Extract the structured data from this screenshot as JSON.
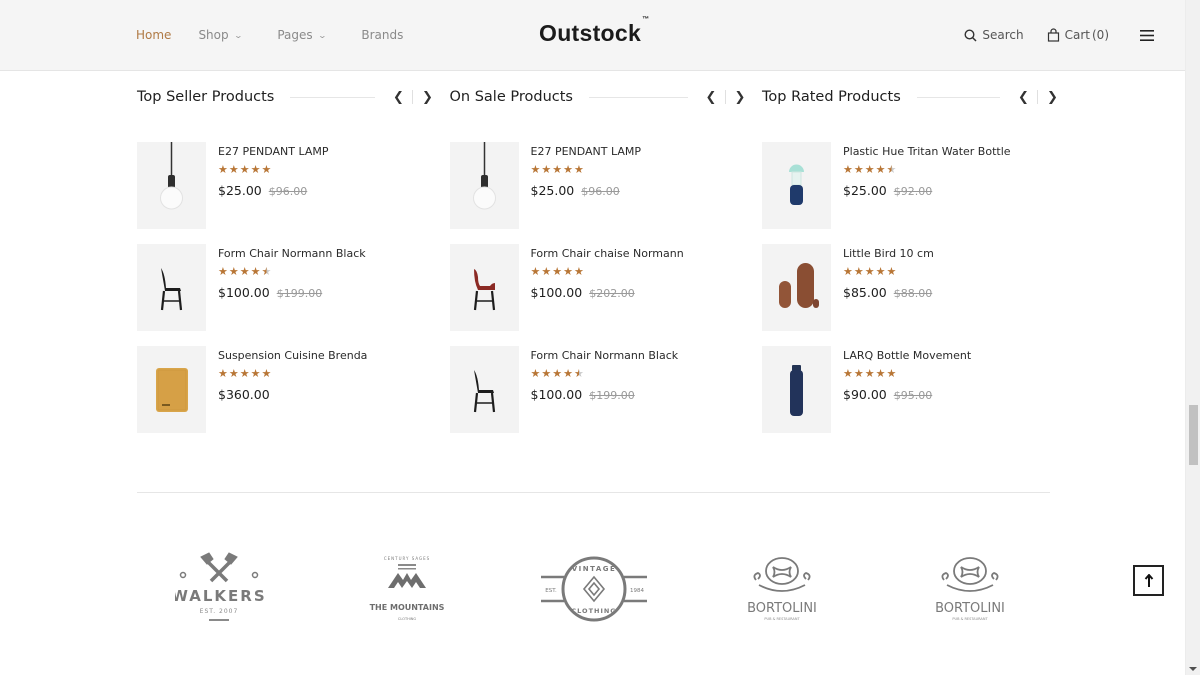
{
  "header": {
    "nav": [
      {
        "label": "Home",
        "active": true,
        "dropdown": false
      },
      {
        "label": "Shop",
        "active": false,
        "dropdown": true
      },
      {
        "label": "Pages",
        "active": false,
        "dropdown": true
      },
      {
        "label": "Brands",
        "active": false,
        "dropdown": false
      }
    ],
    "logo": "Outstock",
    "logo_tm": "™",
    "search_label": "Search",
    "cart_label": "Cart",
    "cart_count": "(0)",
    "icons": {
      "search": "search-icon",
      "cart": "shopping-bag-icon",
      "menu": "hamburger-menu-icon"
    }
  },
  "sections": [
    {
      "title": "Top Seller Products",
      "products": [
        {
          "name": "E27 PENDANT LAMP",
          "rating": 5,
          "price": "$25.00",
          "old_price": "$96.00",
          "image": "pendant-lamp"
        },
        {
          "name": "Form Chair Normann Black",
          "rating": 4.5,
          "price": "$100.00",
          "old_price": "$199.00",
          "image": "black-chair"
        },
        {
          "name": "Suspension Cuisine Brenda",
          "rating": 5,
          "price": "$360.00",
          "old_price": "",
          "image": "speaker"
        }
      ]
    },
    {
      "title": "On Sale Products",
      "products": [
        {
          "name": "E27 PENDANT LAMP",
          "rating": 5,
          "price": "$25.00",
          "old_price": "$96.00",
          "image": "pendant-lamp"
        },
        {
          "name": "Form Chair chaise Normann",
          "rating": 5,
          "price": "$100.00",
          "old_price": "$202.00",
          "image": "red-chair"
        },
        {
          "name": "Form Chair Normann Black",
          "rating": 4.5,
          "price": "$100.00",
          "old_price": "$199.00",
          "image": "black-chair"
        }
      ]
    },
    {
      "title": "Top Rated Products",
      "products": [
        {
          "name": "Plastic Hue Tritan Water Bottle",
          "rating": 4.5,
          "price": "$25.00",
          "old_price": "$92.00",
          "image": "water-bottle"
        },
        {
          "name": "Little Bird 10 cm",
          "rating": 5,
          "price": "$85.00",
          "old_price": "$88.00",
          "image": "wood-birds"
        },
        {
          "name": "LARQ Bottle Movement",
          "rating": 5,
          "price": "$90.00",
          "old_price": "$95.00",
          "image": "navy-bottle"
        }
      ]
    }
  ],
  "brands": [
    {
      "name": "WALKERS",
      "sub": "EST. 2007"
    },
    {
      "name": "THE MOUNTAINS",
      "sub": "CLOTHING",
      "top": "CENTURY SAGES"
    },
    {
      "name": "VINTAGE",
      "sub": "CLOTHING",
      "left": "EST.",
      "right": "1984"
    },
    {
      "name": "BORTOLINI",
      "sub": "PUB & RESTAURANT"
    },
    {
      "name": "BORTOLINI",
      "sub": "PUB & RESTAURANT"
    }
  ],
  "back_to_top": "back-to-top-icon",
  "colors": {
    "accent": "#b07a45",
    "star": "#b87636",
    "header_bg": "#f5f5f5",
    "logo_gray": "#7a7a7a"
  }
}
